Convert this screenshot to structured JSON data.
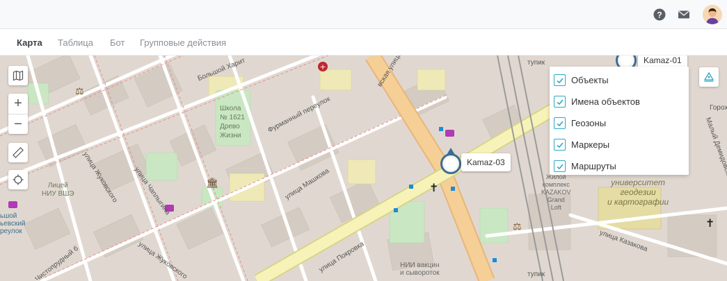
{
  "header": {
    "help_icon": "help-circle-icon",
    "mail_icon": "mail-icon",
    "avatar_icon": "user-avatar"
  },
  "tabs": [
    {
      "label": "Карта",
      "active": true
    },
    {
      "label": "Таблица",
      "active": false
    },
    {
      "label": "Бот",
      "active": false
    },
    {
      "label": "Групповые действия",
      "active": false
    }
  ],
  "map": {
    "controls": {
      "zoom_in": "+",
      "zoom_out": "−"
    },
    "layers": [
      {
        "label": "Объекты",
        "checked": true
      },
      {
        "label": "Имена объектов",
        "checked": true
      },
      {
        "label": "Геозоны",
        "checked": true
      },
      {
        "label": "Маркеры",
        "checked": true
      },
      {
        "label": "Маршруты",
        "checked": true
      }
    ],
    "vehicles": [
      {
        "name": "Kamaz-03"
      },
      {
        "name": "Kamaz-01"
      }
    ],
    "labels": {
      "school": "Школа\n№ 1621\nДрево\nЖизни",
      "lyceum": "Лицей\nНИУ ВШЭ",
      "university": "университет\nгеодезии\nи картографии",
      "complex": "Жилой\nкомплекс\nKAZAKOV\nGrand\nLoft",
      "nii": "НИИ вакцин\nи сывороток",
      "sumy": "ьшой\nьевский\nреулок",
      "gorokh": "Горох"
    },
    "streets": {
      "kharit": "Большой Харит",
      "furman": "Фурманный переулок",
      "mashkova": "улица Машкова",
      "chaplygina": "улица Чаплыгина",
      "zhukovsky1": "улица Жуковского",
      "zhukovsky2": "улица Жуковского",
      "pokrovka": "улица Покровка",
      "kazakova": "улица Казакова",
      "chistoprudny": "Чистопрудный б",
      "tupik1": "тупик",
      "tupik2": "тупик",
      "maly_demid": "Малый Демидовский",
      "yanskaya": "вская улица"
    }
  }
}
